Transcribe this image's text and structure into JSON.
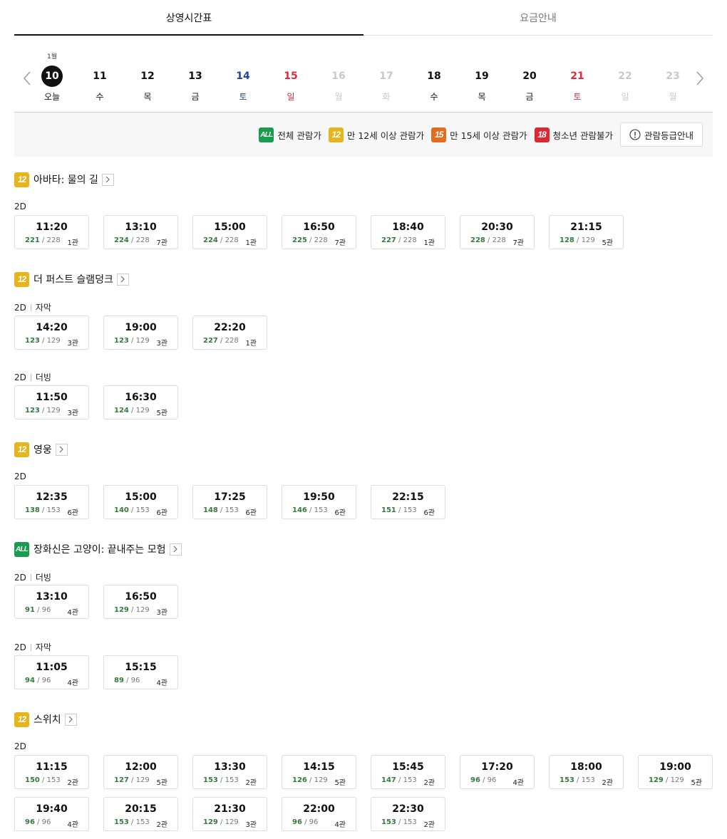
{
  "tabs": [
    {
      "label": "상영시간표",
      "active": true
    },
    {
      "label": "요금안내",
      "active": false
    }
  ],
  "dates": {
    "month": "1월",
    "prev_icon": "chevron-left-icon",
    "next_icon": "chevron-right-icon",
    "days": [
      {
        "num": "10",
        "dow": "오늘",
        "type": "today"
      },
      {
        "num": "11",
        "dow": "수",
        "type": "normal"
      },
      {
        "num": "12",
        "dow": "목",
        "type": "normal"
      },
      {
        "num": "13",
        "dow": "금",
        "type": "normal"
      },
      {
        "num": "14",
        "dow": "토",
        "type": "sat"
      },
      {
        "num": "15",
        "dow": "일",
        "type": "sun"
      },
      {
        "num": "16",
        "dow": "월",
        "type": "disabled"
      },
      {
        "num": "17",
        "dow": "화",
        "type": "disabled"
      },
      {
        "num": "18",
        "dow": "수",
        "type": "normal"
      },
      {
        "num": "19",
        "dow": "목",
        "type": "normal"
      },
      {
        "num": "20",
        "dow": "금",
        "type": "normal"
      },
      {
        "num": "21",
        "dow": "토",
        "type": "sun"
      },
      {
        "num": "22",
        "dow": "일",
        "type": "disabled"
      },
      {
        "num": "23",
        "dow": "월",
        "type": "disabled"
      }
    ]
  },
  "legend": {
    "items": [
      {
        "badge": "ALL",
        "cls": "b-all",
        "label": "전체 관람가"
      },
      {
        "badge": "12",
        "cls": "b-12",
        "label": "만 12세 이상 관람가"
      },
      {
        "badge": "15",
        "cls": "b-15",
        "label": "만 15세 이상 관람가"
      },
      {
        "badge": "18",
        "cls": "b-18",
        "label": "청소년 관람불가"
      }
    ],
    "guide_button": "관람등급안내",
    "guide_icon": "info-circle-icon"
  },
  "colors": {
    "all": "#1a9c4e",
    "age12": "#e7b41b",
    "age15": "#e56b1f",
    "age18": "#db2832",
    "seat_available": "#357a3e",
    "saturday": "#2545a8",
    "sunday": "#e0283c"
  },
  "movies": [
    {
      "title": "아바타: 물의 길",
      "rating": "12",
      "rating_cls": "b-12",
      "groups": [
        {
          "format": "2D",
          "sub": "",
          "slots": [
            {
              "time": "11:20",
              "avail": "221",
              "total": "228",
              "hall": "1관"
            },
            {
              "time": "13:10",
              "avail": "224",
              "total": "228",
              "hall": "7관"
            },
            {
              "time": "15:00",
              "avail": "224",
              "total": "228",
              "hall": "1관"
            },
            {
              "time": "16:50",
              "avail": "225",
              "total": "228",
              "hall": "7관"
            },
            {
              "time": "18:40",
              "avail": "227",
              "total": "228",
              "hall": "1관"
            },
            {
              "time": "20:30",
              "avail": "228",
              "total": "228",
              "hall": "7관"
            },
            {
              "time": "21:15",
              "avail": "128",
              "total": "129",
              "hall": "5관"
            }
          ]
        }
      ]
    },
    {
      "title": "더 퍼스트 슬램덩크",
      "rating": "12",
      "rating_cls": "b-12",
      "groups": [
        {
          "format": "2D",
          "sub": "자막",
          "slots": [
            {
              "time": "14:20",
              "avail": "123",
              "total": "129",
              "hall": "3관"
            },
            {
              "time": "19:00",
              "avail": "123",
              "total": "129",
              "hall": "3관"
            },
            {
              "time": "22:20",
              "avail": "227",
              "total": "228",
              "hall": "1관"
            }
          ]
        },
        {
          "format": "2D",
          "sub": "더빙",
          "slots": [
            {
              "time": "11:50",
              "avail": "123",
              "total": "129",
              "hall": "3관"
            },
            {
              "time": "16:30",
              "avail": "124",
              "total": "129",
              "hall": "5관"
            }
          ]
        }
      ]
    },
    {
      "title": "영웅",
      "rating": "12",
      "rating_cls": "b-12",
      "groups": [
        {
          "format": "2D",
          "sub": "",
          "slots": [
            {
              "time": "12:35",
              "avail": "138",
              "total": "153",
              "hall": "6관"
            },
            {
              "time": "15:00",
              "avail": "140",
              "total": "153",
              "hall": "6관"
            },
            {
              "time": "17:25",
              "avail": "148",
              "total": "153",
              "hall": "6관"
            },
            {
              "time": "19:50",
              "avail": "146",
              "total": "153",
              "hall": "6관"
            },
            {
              "time": "22:15",
              "avail": "151",
              "total": "153",
              "hall": "6관"
            }
          ]
        }
      ]
    },
    {
      "title": "장화신은 고양이: 끝내주는 모험",
      "rating": "ALL",
      "rating_cls": "b-all",
      "groups": [
        {
          "format": "2D",
          "sub": "더빙",
          "slots": [
            {
              "time": "13:10",
              "avail": "91",
              "total": "96",
              "hall": "4관"
            },
            {
              "time": "16:50",
              "avail": "129",
              "total": "129",
              "hall": "3관"
            }
          ]
        },
        {
          "format": "2D",
          "sub": "자막",
          "slots": [
            {
              "time": "11:05",
              "avail": "94",
              "total": "96",
              "hall": "4관"
            },
            {
              "time": "15:15",
              "avail": "89",
              "total": "96",
              "hall": "4관"
            }
          ]
        }
      ]
    },
    {
      "title": "스위치",
      "rating": "12",
      "rating_cls": "b-12",
      "groups": [
        {
          "format": "2D",
          "sub": "",
          "slots": [
            {
              "time": "11:15",
              "avail": "150",
              "total": "153",
              "hall": "2관"
            },
            {
              "time": "12:00",
              "avail": "127",
              "total": "129",
              "hall": "5관"
            },
            {
              "time": "13:30",
              "avail": "153",
              "total": "153",
              "hall": "2관"
            },
            {
              "time": "14:15",
              "avail": "126",
              "total": "129",
              "hall": "5관"
            },
            {
              "time": "15:45",
              "avail": "147",
              "total": "153",
              "hall": "2관"
            },
            {
              "time": "17:20",
              "avail": "96",
              "total": "96",
              "hall": "4관"
            },
            {
              "time": "18:00",
              "avail": "153",
              "total": "153",
              "hall": "2관"
            },
            {
              "time": "19:00",
              "avail": "129",
              "total": "129",
              "hall": "5관"
            },
            {
              "time": "19:40",
              "avail": "96",
              "total": "96",
              "hall": "4관"
            },
            {
              "time": "20:15",
              "avail": "153",
              "total": "153",
              "hall": "2관"
            },
            {
              "time": "21:30",
              "avail": "129",
              "total": "129",
              "hall": "3관"
            },
            {
              "time": "22:00",
              "avail": "96",
              "total": "96",
              "hall": "4관"
            },
            {
              "time": "22:30",
              "avail": "153",
              "total": "153",
              "hall": "2관"
            }
          ]
        }
      ]
    }
  ]
}
